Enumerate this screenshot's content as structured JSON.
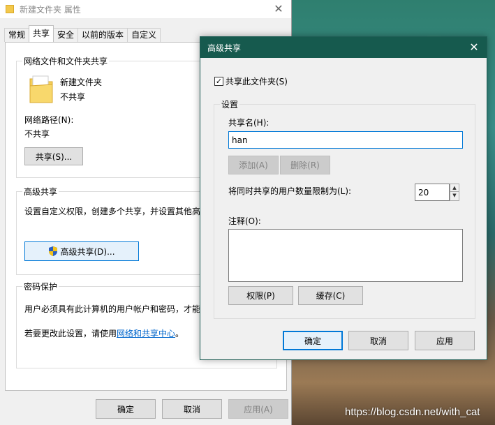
{
  "properties_window": {
    "title": "新建文件夹 属性",
    "tabs": [
      {
        "label": "常规"
      },
      {
        "label": "共享"
      },
      {
        "label": "安全"
      },
      {
        "label": "以前的版本"
      },
      {
        "label": "自定义"
      }
    ],
    "network_sharing": {
      "group_title": "网络文件和文件夹共享",
      "folder_name": "新建文件夹",
      "folder_status": "不共享",
      "network_path_label": "网络路径(N):",
      "network_path_value": "不共享",
      "share_button": "共享(S)..."
    },
    "advanced_sharing": {
      "group_title": "高级共享",
      "description": "设置自定义权限，创建多个共享，并设置其他高",
      "button": "高级共享(D)..."
    },
    "password_protection": {
      "group_title": "密码保护",
      "line1": "用户必须具有此计算机的用户帐户和密码，才能",
      "line2_prefix": "若要更改此设置，请使用",
      "line2_link": "网络和共享中心",
      "line2_suffix": "。"
    },
    "footer": {
      "ok": "确定",
      "cancel": "取消",
      "apply": "应用(A)"
    }
  },
  "advanced_dialog": {
    "title": "高级共享",
    "share_checkbox_label": "共享此文件夹(S)",
    "share_checked": true,
    "settings_group_title": "设置",
    "share_name_label": "共享名(H):",
    "share_name_value": "han",
    "add_button": "添加(A)",
    "remove_button": "删除(R)",
    "user_limit_label": "将同时共享的用户数量限制为(L):",
    "user_limit_value": "20",
    "comment_label": "注释(O):",
    "comment_value": "",
    "permissions_button": "权限(P)",
    "caching_button": "缓存(C)",
    "ok": "确定",
    "cancel": "取消",
    "apply": "应用"
  },
  "watermark": "https://blog.csdn.net/with_cat",
  "colors": {
    "dialog_titlebar": "#165a4e",
    "link": "#0066cc",
    "focus_border": "#0078d7"
  }
}
